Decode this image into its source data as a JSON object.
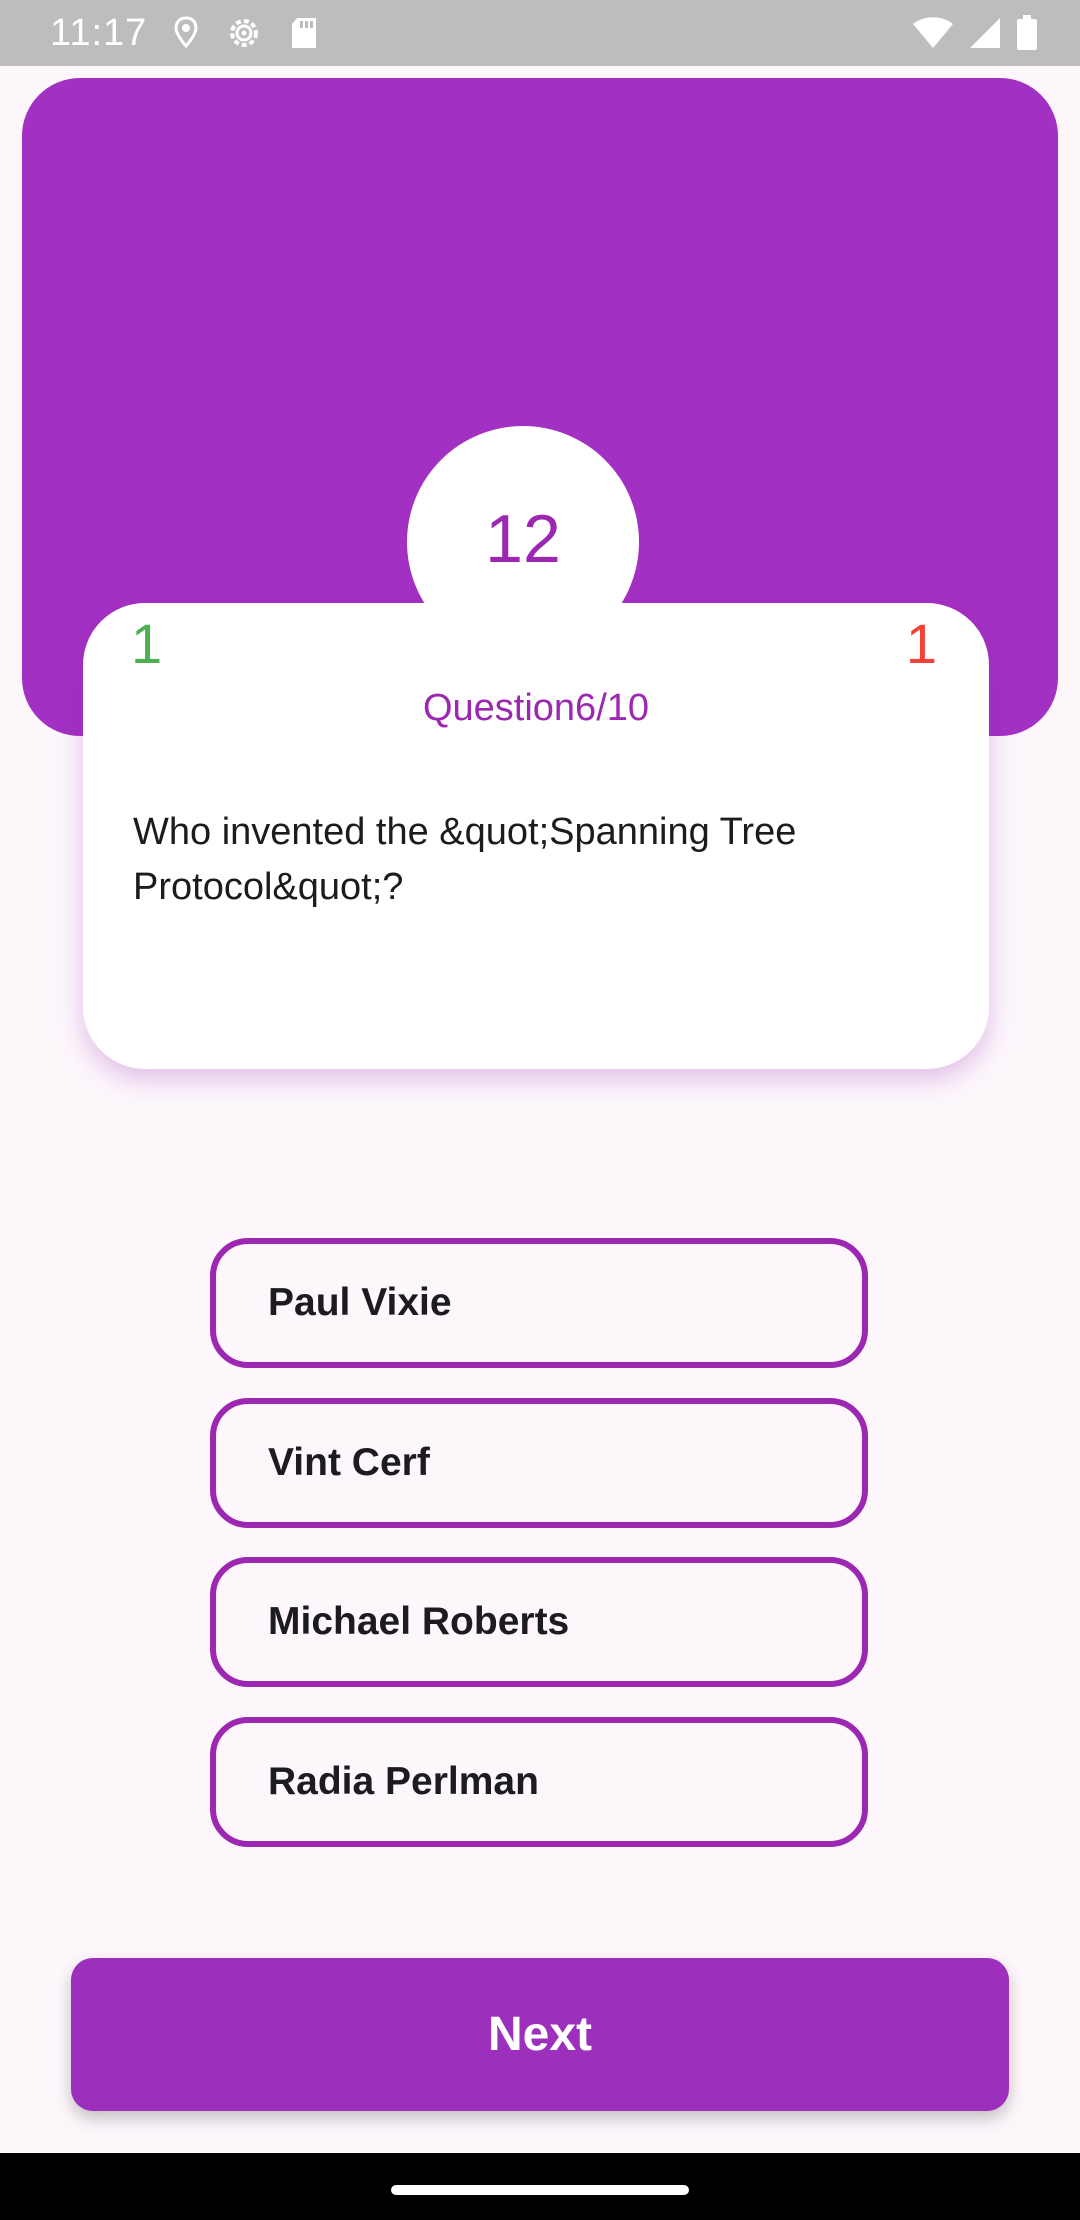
{
  "status_bar": {
    "time": "11:17",
    "icons_left": [
      "location-pin-icon",
      "settings-gear-icon",
      "sd-card-icon"
    ],
    "icons_right": [
      "wifi-icon",
      "signal-icon",
      "battery-icon"
    ]
  },
  "quiz": {
    "timer": "12",
    "correct_count": "1",
    "wrong_count": "1",
    "question_counter": "Question6/10",
    "question_text": "Who invented the &quot;Spanning Tree Protocol&quot;?",
    "options": [
      {
        "label": "Paul Vixie"
      },
      {
        "label": "Vint Cerf"
      },
      {
        "label": "Michael Roberts"
      },
      {
        "label": "Radia Perlman"
      }
    ],
    "next_label": "Next"
  },
  "colors": {
    "primary": "#9c27b0",
    "header": "#a230c2",
    "correct": "#4caf50",
    "wrong": "#f44336",
    "background": "#fdf7fc"
  }
}
